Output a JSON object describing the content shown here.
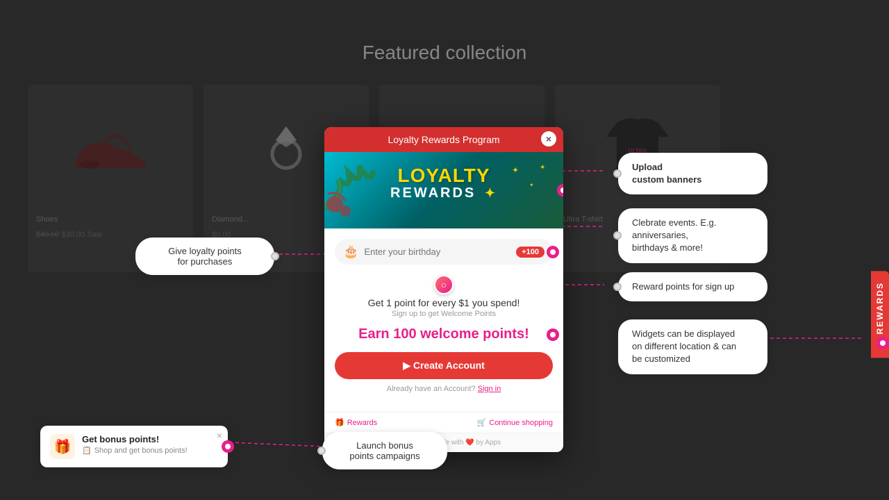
{
  "page": {
    "title": "Featured collection",
    "background_color": "#3a3a3a"
  },
  "modal": {
    "header": "Loyalty Rewards Program",
    "close_label": "×",
    "banner": {
      "line1": "LOYALTY",
      "line2": "REWARDS",
      "star": "✦"
    },
    "birthday_placeholder": "Enter your birthday",
    "points_badge": "+100",
    "earn_title": "Get 1 point for every $1 you spend!",
    "earn_sub": "Sign up to get Welcome Points",
    "welcome_points": "Earn 100 welcome points!",
    "create_account_btn": "▶ Create Account",
    "already_account": "Already have an Account?",
    "sign_in": "Sign in",
    "footer_rewards": "Rewards",
    "footer_continue": "Continue shopping",
    "attribution": "Gratisfaction · Made with ❤️ by Apps"
  },
  "annotations": {
    "give_points": "Give loyalty points\nfor purchases",
    "upload_banners": "Upload\ncustom banners",
    "celebrate_events": "Clebrate events. E.g.\nanniversaries,\nbirthdays & more!",
    "reward_signup": "Reward points for sign up",
    "widgets": "Widgets can be displayed\non different location & can\nbe customized",
    "launch_bonus": "Launch bonus\npoints campaigns"
  },
  "bonus_widget": {
    "title": "Get bonus points!",
    "subtitle": "Shop and get bonus points!",
    "close": "×",
    "icon": "🎁"
  },
  "rewards_tab": {
    "label": "REWARDS"
  },
  "connectors": {
    "color": "#e91e8c"
  }
}
